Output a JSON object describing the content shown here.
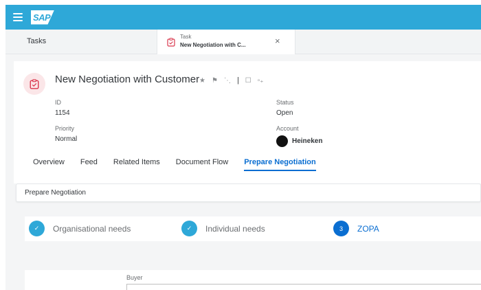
{
  "shell": {
    "logo": "SAP"
  },
  "tabs": {
    "tasks_label": "Tasks",
    "active_small": "Task",
    "active_title": "New Negotiation with C...",
    "close_symbol": "×"
  },
  "header": {
    "title": "New Negotiation with Customer",
    "actions": {
      "star": "★",
      "flag": "⚑",
      "feed": "⋱",
      "divider": "|",
      "comment": "☐",
      "more": "▫₊"
    },
    "fields": {
      "id_label": "ID",
      "id_value": "1154",
      "priority_label": "Priority",
      "priority_value": "Normal",
      "status_label": "Status",
      "status_value": "Open",
      "account_label": "Account",
      "account_value": "Heineken"
    }
  },
  "section_tabs": [
    "Overview",
    "Feed",
    "Related Items",
    "Document Flow",
    "Prepare Negotiation"
  ],
  "section_title": "Prepare Negotiation",
  "steps": [
    {
      "label": "Organisational needs",
      "state": "done",
      "marker": "✓"
    },
    {
      "label": "Individual needs",
      "state": "done",
      "marker": "✓"
    },
    {
      "label": "ZOPA",
      "state": "current",
      "marker": "3"
    }
  ],
  "form": {
    "buyer_label": "Buyer",
    "buyer_value": ""
  },
  "colors": {
    "shell": "#2ea8d8",
    "accent": "#0a6ed1",
    "icon_bg": "#fbe6e8",
    "icon": "#d9364c"
  },
  "icons": {
    "menu": "hamburger-icon",
    "task": "clipboard-icon",
    "close": "close-icon",
    "check": "checkmark-icon"
  }
}
